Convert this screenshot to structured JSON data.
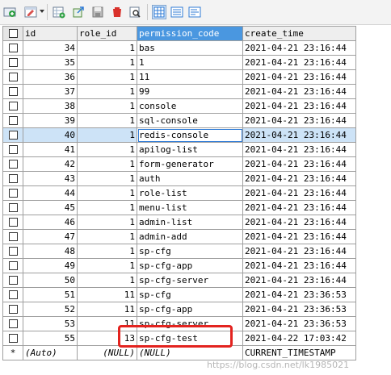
{
  "toolbar": {
    "icons": [
      "add-row-icon",
      "edit-dropdown-icon",
      "table-add-icon",
      "export-icon",
      "save-icon",
      "delete-icon",
      "filter-icon",
      "grid-view-icon",
      "form-view-icon",
      "text-view-icon"
    ]
  },
  "table": {
    "columns": [
      "id",
      "role_id",
      "permission_code",
      "create_time"
    ],
    "active_column": "permission_code",
    "rows": [
      {
        "id": "34",
        "role_id": "1",
        "permission_code": "bas",
        "create_time": "2021-04-21 23:16:44"
      },
      {
        "id": "35",
        "role_id": "1",
        "permission_code": "1",
        "create_time": "2021-04-21 23:16:44"
      },
      {
        "id": "36",
        "role_id": "1",
        "permission_code": "11",
        "create_time": "2021-04-21 23:16:44"
      },
      {
        "id": "37",
        "role_id": "1",
        "permission_code": "99",
        "create_time": "2021-04-21 23:16:44"
      },
      {
        "id": "38",
        "role_id": "1",
        "permission_code": "console",
        "create_time": "2021-04-21 23:16:44"
      },
      {
        "id": "39",
        "role_id": "1",
        "permission_code": "sql-console",
        "create_time": "2021-04-21 23:16:44"
      },
      {
        "id": "40",
        "role_id": "1",
        "permission_code": "redis-console",
        "create_time": "2021-04-21 23:16:44"
      },
      {
        "id": "41",
        "role_id": "1",
        "permission_code": "apilog-list",
        "create_time": "2021-04-21 23:16:44"
      },
      {
        "id": "42",
        "role_id": "1",
        "permission_code": "form-generator",
        "create_time": "2021-04-21 23:16:44"
      },
      {
        "id": "43",
        "role_id": "1",
        "permission_code": "auth",
        "create_time": "2021-04-21 23:16:44"
      },
      {
        "id": "44",
        "role_id": "1",
        "permission_code": "role-list",
        "create_time": "2021-04-21 23:16:44"
      },
      {
        "id": "45",
        "role_id": "1",
        "permission_code": "menu-list",
        "create_time": "2021-04-21 23:16:44"
      },
      {
        "id": "46",
        "role_id": "1",
        "permission_code": "admin-list",
        "create_time": "2021-04-21 23:16:44"
      },
      {
        "id": "47",
        "role_id": "1",
        "permission_code": "admin-add",
        "create_time": "2021-04-21 23:16:44"
      },
      {
        "id": "48",
        "role_id": "1",
        "permission_code": "sp-cfg",
        "create_time": "2021-04-21 23:16:44"
      },
      {
        "id": "49",
        "role_id": "1",
        "permission_code": "sp-cfg-app",
        "create_time": "2021-04-21 23:16:44"
      },
      {
        "id": "50",
        "role_id": "1",
        "permission_code": "sp-cfg-server",
        "create_time": "2021-04-21 23:16:44"
      },
      {
        "id": "51",
        "role_id": "11",
        "permission_code": "sp-cfg",
        "create_time": "2021-04-21 23:36:53"
      },
      {
        "id": "52",
        "role_id": "11",
        "permission_code": "sp-cfg-app",
        "create_time": "2021-04-21 23:36:53"
      },
      {
        "id": "53",
        "role_id": "11",
        "permission_code": "sp-cfg-server",
        "create_time": "2021-04-21 23:36:53"
      },
      {
        "id": "55",
        "role_id": "13",
        "permission_code": "sp-cfg-test",
        "create_time": "2021-04-22 17:03:42"
      }
    ],
    "selected_row_index": 6,
    "new_row": {
      "marker": "*",
      "id": "(Auto)",
      "role_id": "(NULL)",
      "permission_code": "(NULL)",
      "create_time": "CURRENT_TIMESTAMP"
    }
  },
  "watermark": "https://blog.csdn.net/lk1985021",
  "colors": {
    "active_header": "#4a97e0",
    "selected_row": "#cde3f7",
    "highlight_box": "#e3231f"
  }
}
